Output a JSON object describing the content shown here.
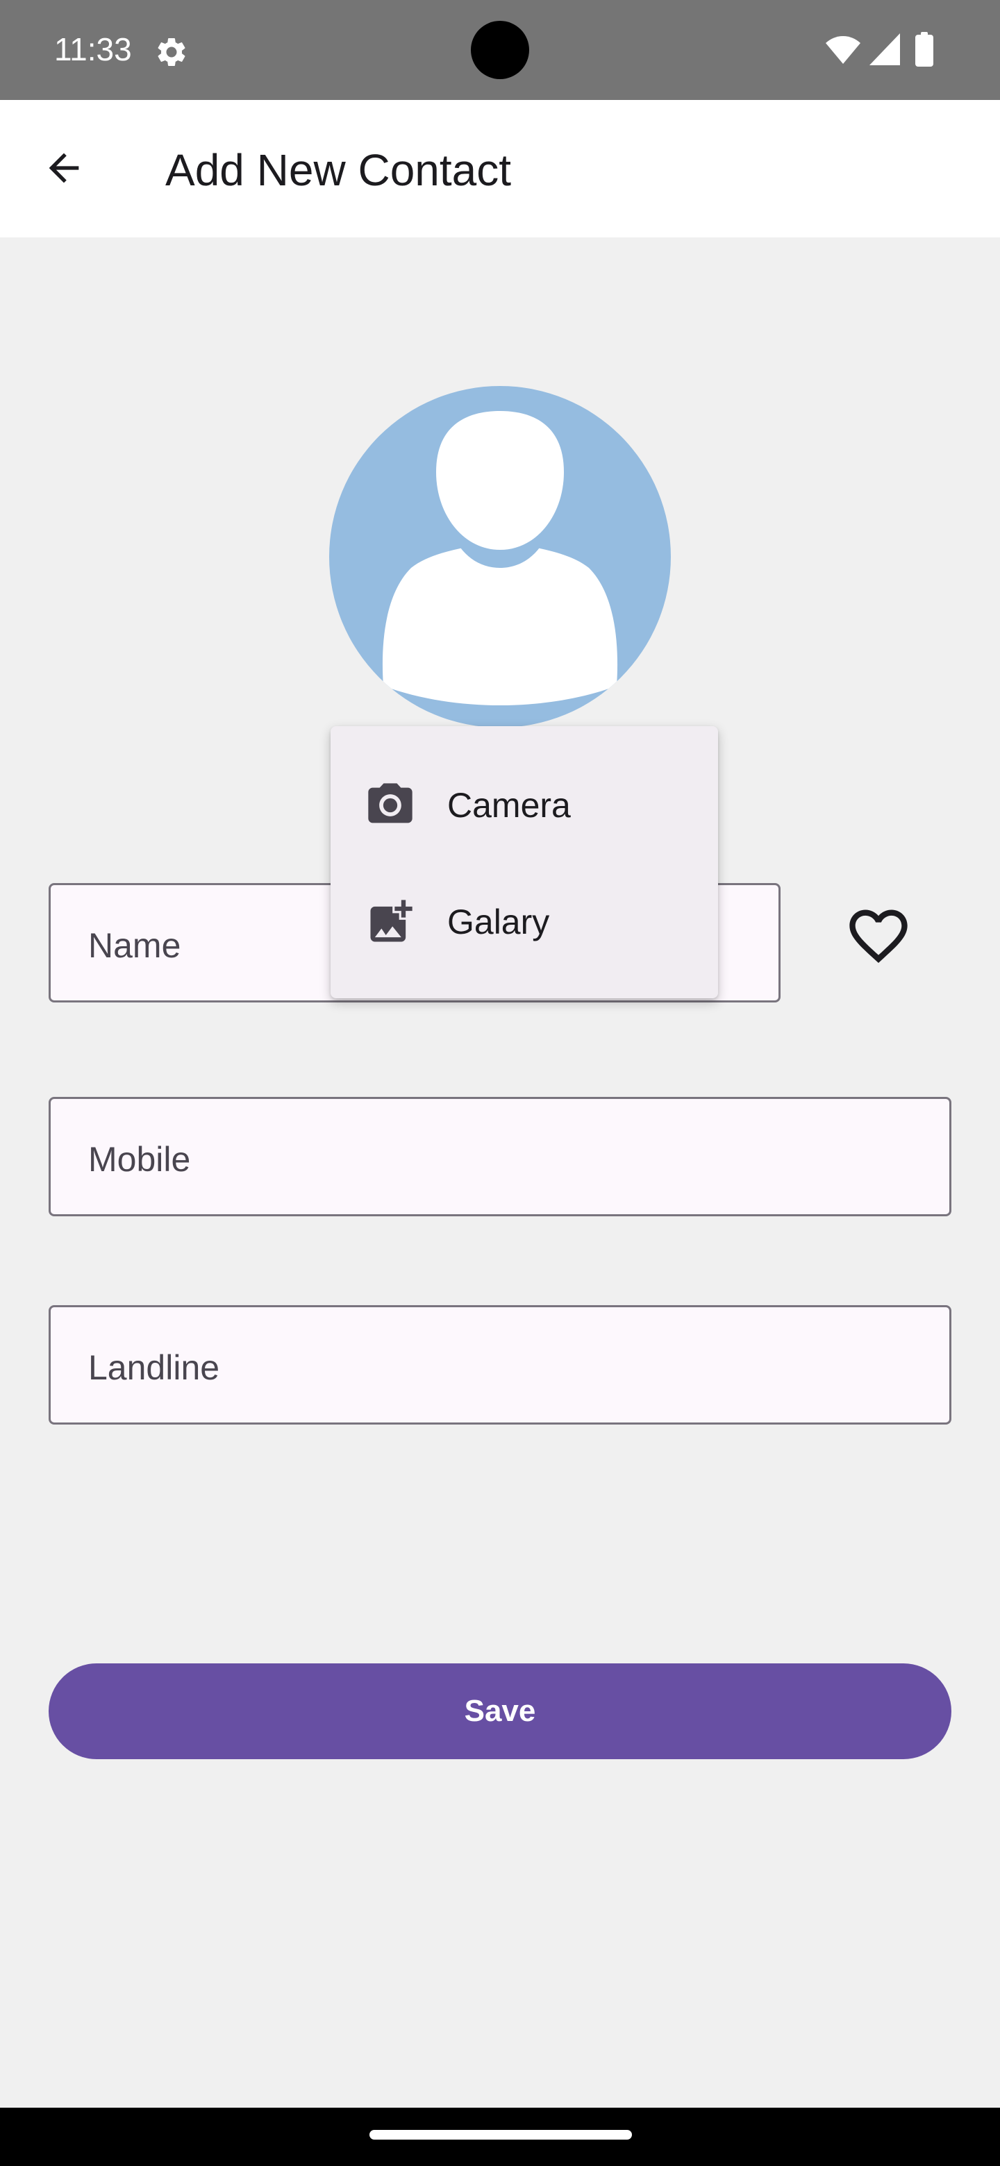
{
  "status_bar": {
    "time": "11:33",
    "icons": [
      "gear-icon",
      "wifi-icon",
      "signal-icon",
      "battery-icon"
    ]
  },
  "app_bar": {
    "title": "Add New Contact",
    "back_icon": "arrow-back-icon"
  },
  "avatar": {
    "icon": "person-placeholder-icon",
    "background_color": "#95bce0"
  },
  "form": {
    "name": {
      "label": "Name",
      "value": ""
    },
    "mobile": {
      "label": "Mobile",
      "value": ""
    },
    "landline": {
      "label": "Landline",
      "value": ""
    },
    "favorite_icon": "heart-outline-icon"
  },
  "photo_menu": {
    "items": [
      {
        "label": "Camera",
        "icon": "camera-icon"
      },
      {
        "label": "Galary",
        "icon": "add-photo-icon"
      }
    ]
  },
  "save_button": {
    "label": "Save",
    "color": "#674fa3"
  }
}
